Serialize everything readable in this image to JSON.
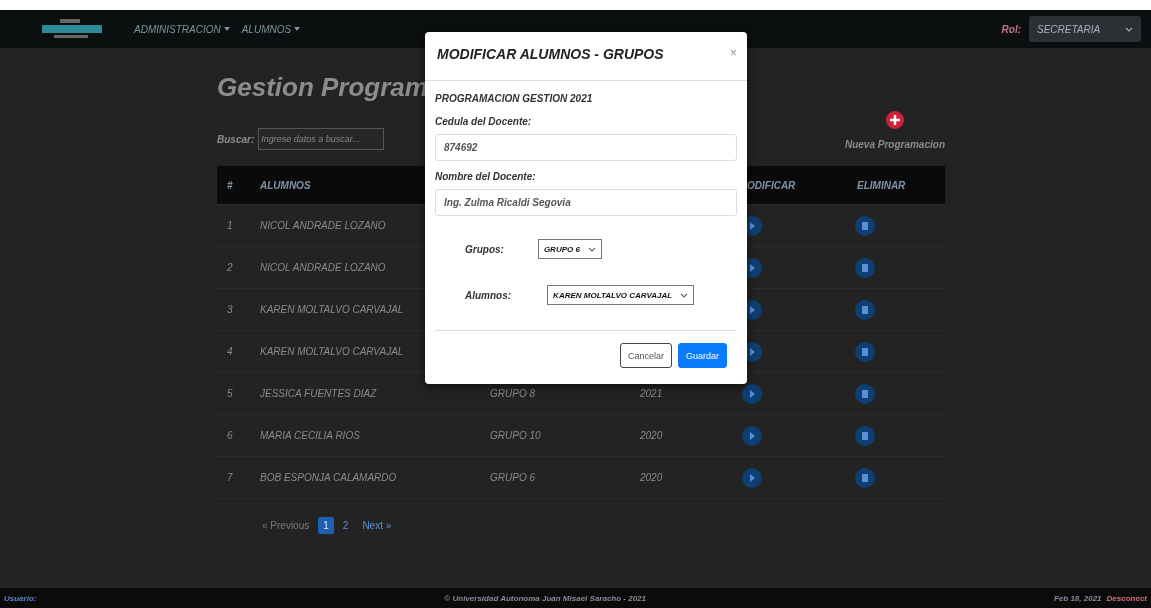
{
  "navbar": {
    "menus": [
      {
        "label": "ADMINISTRACION"
      },
      {
        "label": "ALUMNOS"
      }
    ],
    "role_label": "Rol:",
    "role_value": "SECRETARIA"
  },
  "page": {
    "title": "Gestion Program",
    "search_label": "Buscar:",
    "search_placeholder": "Ingrese datos a buscar...",
    "new_label": "Nueva Programacion"
  },
  "table": {
    "columns": [
      "#",
      "ALUMNOS",
      "",
      "",
      "ODIFICAR",
      "ELIMINAR"
    ],
    "rows": [
      {
        "number": "1",
        "name": "NICOL ANDRADE LOZANO"
      },
      {
        "number": "2",
        "name": "NICOL ANDRADE LOZANO"
      },
      {
        "number": "3",
        "name": "KAREN MOLTALVO CARVAJAL"
      },
      {
        "number": "4",
        "name": "KAREN MOLTALVO CARVAJAL"
      },
      {
        "number": "5",
        "name": "JESSICA FUENTES DIAZ",
        "group": "GRUPO 8",
        "year": "2021"
      },
      {
        "number": "6",
        "name": "MARIA CECILIA RIOS",
        "group": "GRUPO 10",
        "year": "2020"
      },
      {
        "number": "7",
        "name": "BOB ESPONJA CALAMARDO",
        "group": "GRUPO 6",
        "year": "2020"
      }
    ]
  },
  "pagination": [
    {
      "label": "« Previous",
      "selected": false,
      "disabled": true
    },
    {
      "label": "1",
      "selected": true,
      "disabled": false
    },
    {
      "label": "2",
      "selected": false,
      "disabled": false
    },
    {
      "label": "Next »",
      "selected": false,
      "disabled": false
    }
  ],
  "footer": {
    "user_label": "Usuario:",
    "copyright": "© Universidad Autonoma Juan Misael Saracho - 2021",
    "date": "Feb 18, 2021",
    "logout": "Desconect"
  },
  "modal": {
    "title": "MODIFICAR ALUMNOS - GRUPOS",
    "close": "×",
    "subtitle": "PROGRAMACION GESTION 2021",
    "fields": [
      {
        "label": "Cedula del Docente:",
        "value": "874692"
      },
      {
        "label": "Nombre del Docente:",
        "value": "Ing. Zulma Ricaldi Segovia"
      }
    ],
    "selects": [
      {
        "label": "Grupos:",
        "value": "GRUPO 6"
      },
      {
        "label": "Alumnos:",
        "value": "KAREN MOLTALVO CARVAJAL"
      }
    ],
    "buttons": [
      {
        "label": "Cancelar",
        "kind": "secondary"
      },
      {
        "label": "Guardar",
        "kind": "primary"
      }
    ]
  }
}
